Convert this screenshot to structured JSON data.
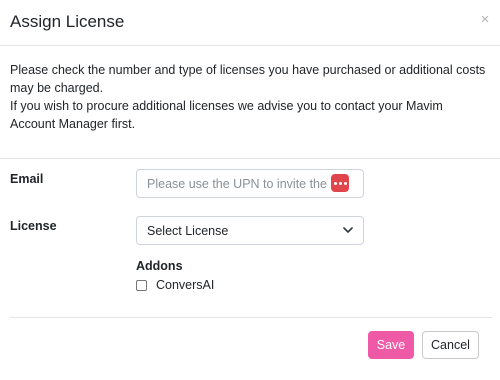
{
  "dialog": {
    "title": "Assign License",
    "close_symbol": "×"
  },
  "intro": {
    "line1": "Please check the number and type of licenses you have purchased or additional costs may be charged.",
    "line2": "If you wish to procure additional licenses we advise you to contact your Mavim Account Manager first."
  },
  "form": {
    "email_label": "Email",
    "email_placeholder": "Please use the UPN to invite the user",
    "email_value": "",
    "license_label": "License",
    "license_selected": "Select License",
    "addons_title": "Addons",
    "addons": [
      {
        "label": "ConversAI",
        "checked": false
      }
    ]
  },
  "footer": {
    "save_label": "Save",
    "cancel_label": "Cancel"
  },
  "colors": {
    "save_button": "#ef5aa6",
    "password_manager_badge": "#e0454b"
  },
  "icons": {
    "close": "close-icon",
    "password_manager": "password-manager-icon",
    "select_caret": "chevron-down-icon"
  }
}
